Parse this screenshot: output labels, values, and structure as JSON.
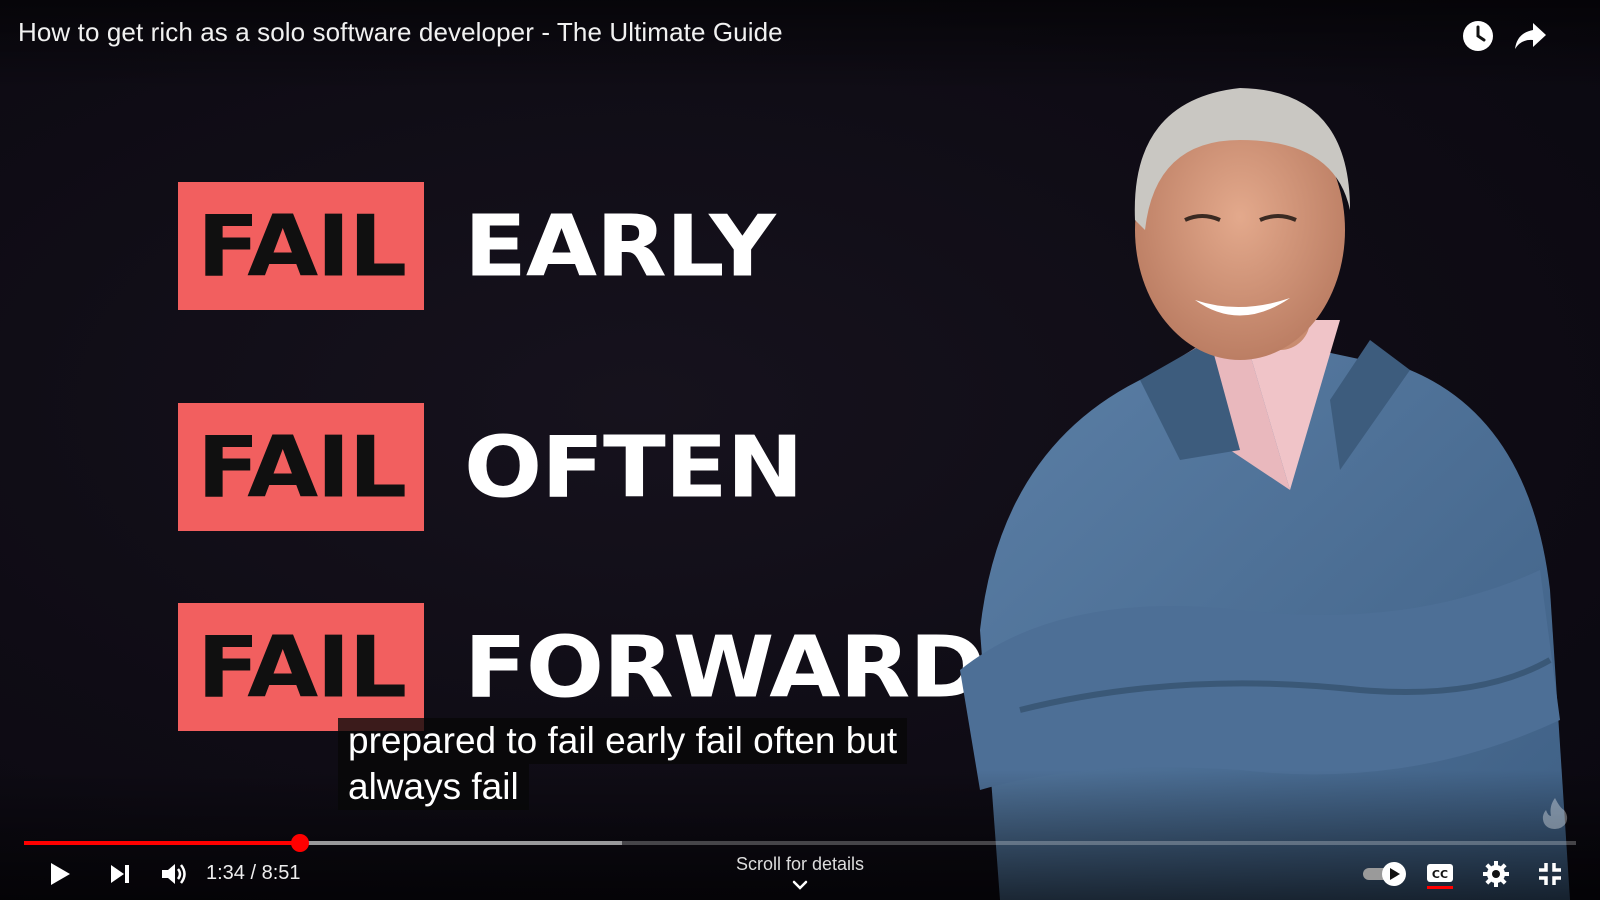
{
  "video": {
    "title": "How to get rich as a solo software developer - The Ultimate Guide",
    "phrases": [
      {
        "fail": "FAIL",
        "word": "EARLY"
      },
      {
        "fail": "FAIL",
        "word": "OFTEN"
      },
      {
        "fail": "FAIL",
        "word": "FORWARD"
      }
    ],
    "captions": [
      "prepared to fail early fail often but",
      "always fail"
    ]
  },
  "player": {
    "current_time": "1:34",
    "duration": "8:51",
    "time_display": "1:34 / 8:51",
    "played_fraction": 0.178,
    "loaded_fraction": 0.385,
    "scroll_hint": "Scroll for details",
    "accent_color": "#ff0000"
  },
  "icons": {
    "top": [
      "watch-later-icon",
      "share-icon"
    ],
    "controls_left": [
      "play-icon",
      "next-icon",
      "volume-icon"
    ],
    "controls_right": [
      "autoplay-toggle-icon",
      "captions-icon",
      "settings-icon",
      "exit-fullscreen-icon"
    ]
  },
  "colors": {
    "fail_box": "#f25f5f",
    "background": "#0d0b13"
  }
}
